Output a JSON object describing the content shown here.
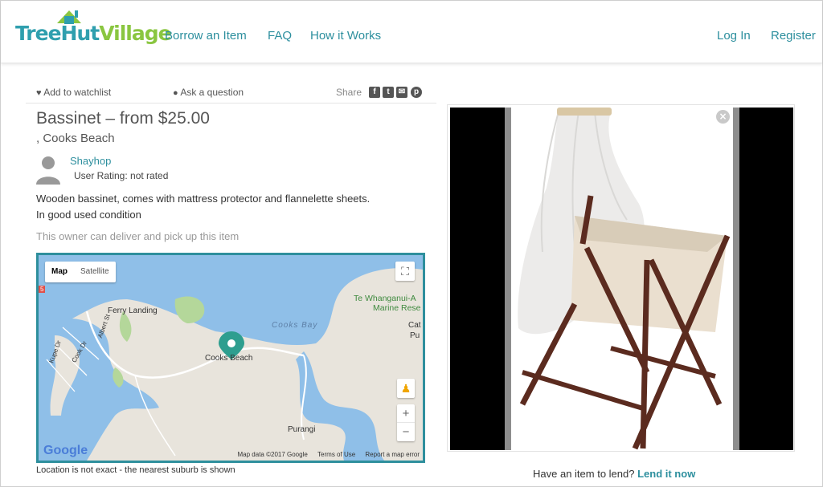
{
  "brand": {
    "logo_text_1": "Tree",
    "logo_text_2": "Hut",
    "logo_text_3": "Village"
  },
  "nav": {
    "borrow": "Borrow an Item",
    "faq": "FAQ",
    "how": "How it Works",
    "login": "Log In",
    "register": "Register"
  },
  "toolbar": {
    "watchlist": "Add to watchlist",
    "ask": "Ask a question",
    "share": "Share"
  },
  "listing": {
    "title": "Bassinet  – from $25.00",
    "location": ", Cooks Beach",
    "owner": "Shayhop",
    "rating": "User Rating: not rated",
    "description_1": "Wooden bassinet, comes with mattress protector and flannelette sheets.",
    "description_2": "In good used condition",
    "delivery": "This owner can deliver and pick up this item"
  },
  "map": {
    "tab_map": "Map",
    "tab_satellite": "Satellite",
    "labels": {
      "ferry": "Ferry Landing",
      "cooks_bay": "Cooks Bay",
      "cooks_beach": "Cooks Beach",
      "reserve": "Te Whanganui-A",
      "reserve2": "Marine Rese",
      "purangi": "Purangi",
      "cat": "Cat",
      "pu": "Pu",
      "albert": "Albert St",
      "cook": "Cook Dr",
      "kupe": "Kupe Dr",
      "five": "5"
    },
    "zoom_in": "+",
    "zoom_out": "−",
    "footer_data": "Map data ©2017 Google",
    "footer_terms": "Terms of Use",
    "footer_error": "Report a map error",
    "google": "Google"
  },
  "note": "Location is not exact - the nearest suburb is shown",
  "lend": {
    "prompt": "Have an item to lend?",
    "link": "Lend it now"
  },
  "colors": {
    "accent": "#2d8f9e",
    "green": "#8ac640",
    "water": "#7fb4e0",
    "land": "#e8e4dc"
  },
  "icons": [
    "heart-icon",
    "comment-icon",
    "facebook-icon",
    "twitter-icon",
    "email-icon",
    "pinterest-icon",
    "close-icon",
    "fullscreen-icon",
    "pegman-icon",
    "map-pin-icon",
    "user-avatar-icon"
  ]
}
